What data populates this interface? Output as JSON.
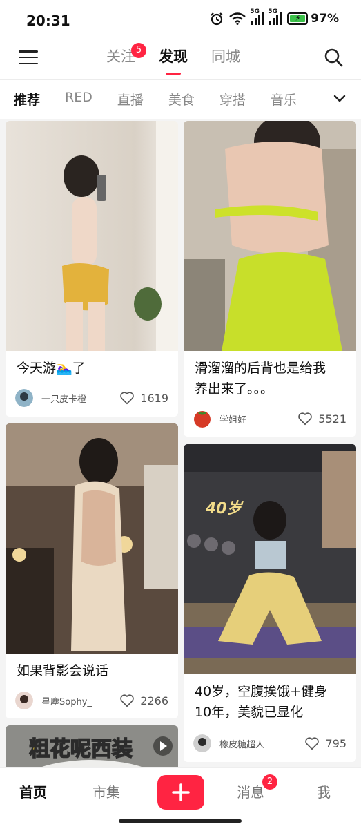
{
  "status_bar": {
    "time": "20:31",
    "network_1": "5G",
    "network_2": "5G",
    "battery": "97%"
  },
  "top_nav": {
    "tabs": [
      {
        "label": "关注",
        "badge": "5"
      },
      {
        "label": "发现"
      },
      {
        "label": "同城"
      }
    ],
    "active_tab": "发现"
  },
  "categories": [
    "推荐",
    "RED",
    "直播",
    "美食",
    "穿搭",
    "音乐"
  ],
  "active_category": "推荐",
  "feed": [
    {
      "title": "今天游🏊‍♀️了",
      "author": "一只皮卡橙",
      "likes": "1619"
    },
    {
      "title_lines": [
        "滑溜溜的后背也是给我",
        "养出来了。。。"
      ],
      "author": "学姐好",
      "likes": "5521"
    },
    {
      "title": "如果背影会说话",
      "author": "星塵Sophy_",
      "likes": "2266"
    },
    {
      "image_text": "40岁",
      "title_lines": [
        "40岁，空腹挨饿+健身",
        "10年，美貌已显化"
      ],
      "author": "橡皮糖超人",
      "likes": "795"
    },
    {
      "image_text": "粗花呢西装"
    }
  ],
  "bottom_nav": {
    "items": [
      "首页",
      "市集",
      "消息",
      "我"
    ],
    "active": "首页",
    "messages_badge": "2"
  },
  "colors": {
    "accent": "#ff2442",
    "text": "#111111",
    "muted": "#888888"
  }
}
